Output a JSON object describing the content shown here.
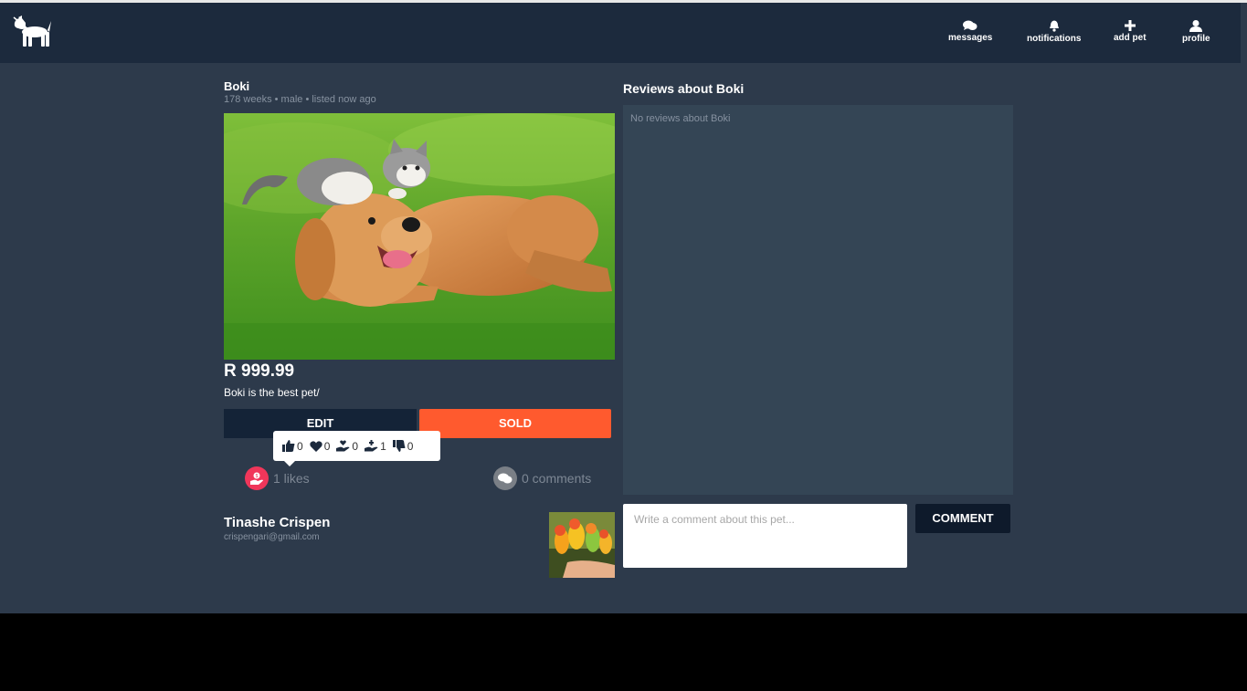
{
  "nav": {
    "messages": "messages",
    "notifications": "notifications",
    "add_pet": "add pet",
    "profile": "profile"
  },
  "pet": {
    "name": "Boki",
    "meta": "178 weeks • male • listed now ago",
    "price": "R 999.99",
    "description": "Boki is the best pet/",
    "edit_label": "EDIT",
    "sold_label": "SOLD"
  },
  "reactions": {
    "like_count": "0",
    "love_count": "0",
    "care_count": "0",
    "adopt_count": "1",
    "dislike_count": "0"
  },
  "stats": {
    "likes_text": "1 likes",
    "comments_text": "0 comments"
  },
  "owner": {
    "name": "Tinashe Crispen",
    "email": "crispengari@gmail.com"
  },
  "reviews": {
    "title": "Reviews about Boki",
    "empty_text": "No reviews about Boki",
    "comment_placeholder": "Write a comment about this pet...",
    "comment_button": "COMMENT"
  },
  "colors": {
    "navbar": "#1c2a3d",
    "page": "#2d3a4b",
    "reviews_box": "#344555",
    "sold": "#ff5a2e",
    "edit": "#142337",
    "likes_badge": "#f0365a"
  }
}
